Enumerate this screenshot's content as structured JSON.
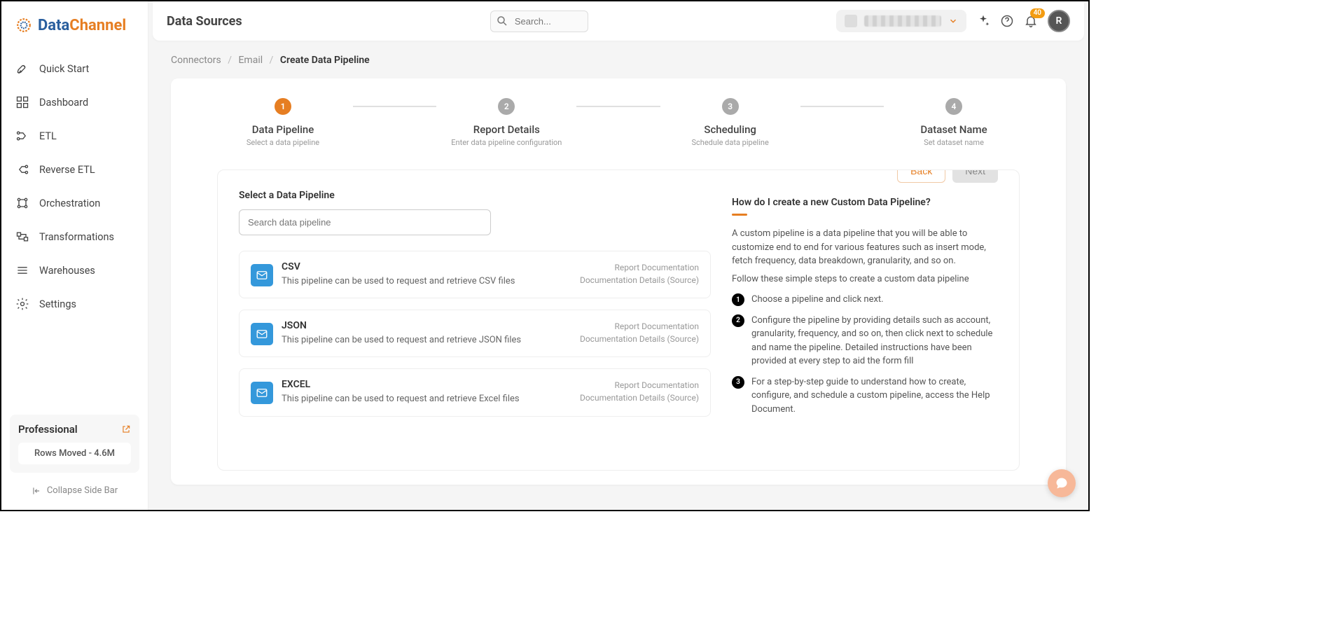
{
  "brand": {
    "name1": "Data",
    "name2": "Channel"
  },
  "sidebar": {
    "items": [
      {
        "label": "Quick Start"
      },
      {
        "label": "Dashboard"
      },
      {
        "label": "ETL"
      },
      {
        "label": "Reverse ETL"
      },
      {
        "label": "Orchestration"
      },
      {
        "label": "Transformations"
      },
      {
        "label": "Warehouses"
      },
      {
        "label": "Settings"
      }
    ],
    "plan": {
      "name": "Professional",
      "rows": "Rows Moved - 4.6M"
    },
    "collapse": "Collapse Side Bar"
  },
  "header": {
    "title": "Data Sources",
    "search_placeholder": "Search...",
    "badge": "40",
    "avatar": "R"
  },
  "breadcrumb": {
    "a": "Connectors",
    "b": "Email",
    "c": "Create Data Pipeline"
  },
  "stepper": [
    {
      "num": "1",
      "title": "Data Pipeline",
      "sub": "Select a data pipeline"
    },
    {
      "num": "2",
      "title": "Report Details",
      "sub": "Enter data pipeline configuration"
    },
    {
      "num": "3",
      "title": "Scheduling",
      "sub": "Schedule data pipeline"
    },
    {
      "num": "4",
      "title": "Dataset Name",
      "sub": "Set dataset name"
    }
  ],
  "section": {
    "title": "Select a Data Pipeline",
    "search_placeholder": "Search data pipeline",
    "back": "Back",
    "next": "Next"
  },
  "pipelines": [
    {
      "title": "CSV",
      "desc": "This pipeline can be used to request and retrieve CSV files",
      "link1": "Report Documentation",
      "link2": "Documentation Details (Source)"
    },
    {
      "title": "JSON",
      "desc": "This pipeline can be used to request and retrieve JSON files",
      "link1": "Report Documentation",
      "link2": "Documentation Details (Source)"
    },
    {
      "title": "EXCEL",
      "desc": "This pipeline can be used to request and retrieve Excel files",
      "link1": "Report Documentation",
      "link2": "Documentation Details (Source)"
    }
  ],
  "help": {
    "title": "How do I create a new Custom Data Pipeline?",
    "p1": "A custom pipeline is a data pipeline that you will be able to customize end to end for various features such as insert mode, fetch frequency, data breakdown, granularity, and so on.",
    "p2": "Follow these simple steps to create a custom data pipeline",
    "steps": [
      "Choose a pipeline and click next.",
      "Configure the pipeline by providing details such as account, granularity, frequency, and so on, then click next to schedule and name the pipeline. Detailed instructions have been provided at every step to aid the form fill",
      "For a step-by-step guide to understand how to create, configure, and schedule a custom pipeline, access the Help Document."
    ]
  }
}
